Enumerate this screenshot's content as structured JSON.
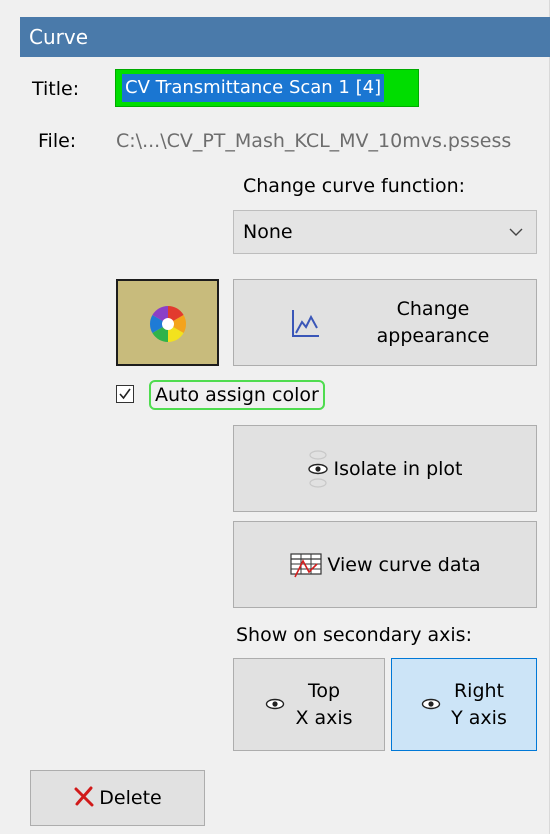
{
  "header": {
    "title": "Curve",
    "color": "#4a7aaa"
  },
  "title_field": {
    "label": "Title:",
    "value": "CV Transmittance Scan 1 [4]",
    "highlight_color": "#00dd00"
  },
  "file_field": {
    "label": "File:",
    "value": "C:\\...\\CV_PT_Mash_KCL_MV_10mvs.pssess"
  },
  "curve_function": {
    "label": "Change curve function:",
    "selected": "None",
    "icon": "chevron-down-icon"
  },
  "color_swatch": {
    "color": "#c8bb7c",
    "icon": "color-wheel-icon"
  },
  "change_appearance": {
    "label_line1": "Change",
    "label_line2": "appearance",
    "icon": "line-chart-icon"
  },
  "auto_assign": {
    "label": "Auto assign color",
    "checked": true
  },
  "isolate": {
    "label": "Isolate in plot",
    "icon": "eye-icon"
  },
  "view_data": {
    "label": "View curve data",
    "icon": "table-chart-icon"
  },
  "secondary_axis": {
    "label": "Show on secondary axis:",
    "top": {
      "line1": "Top",
      "line2": "X axis",
      "active": false
    },
    "right": {
      "line1": "Right",
      "line2": "Y axis",
      "active": true
    }
  },
  "delete": {
    "label": "Delete",
    "icon": "red-x-icon"
  }
}
